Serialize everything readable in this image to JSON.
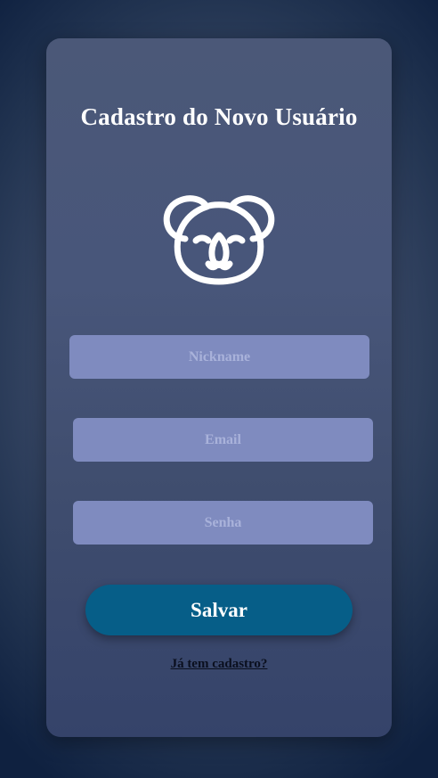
{
  "form": {
    "title": "Cadastro do Novo Usuário",
    "logo_icon": "koala-icon",
    "fields": [
      {
        "placeholder": "Nickname",
        "value": ""
      },
      {
        "placeholder": "Email",
        "value": ""
      },
      {
        "placeholder": "Senha",
        "value": ""
      }
    ],
    "submit_label": "Salvar",
    "login_link": "Já tem cadastro?"
  },
  "colors": {
    "card_background": "#48567a",
    "input_background": "#7f8bbf",
    "button_background": "#065e88",
    "title_text": "#ffffff",
    "link_text": "#0a0f1e"
  }
}
